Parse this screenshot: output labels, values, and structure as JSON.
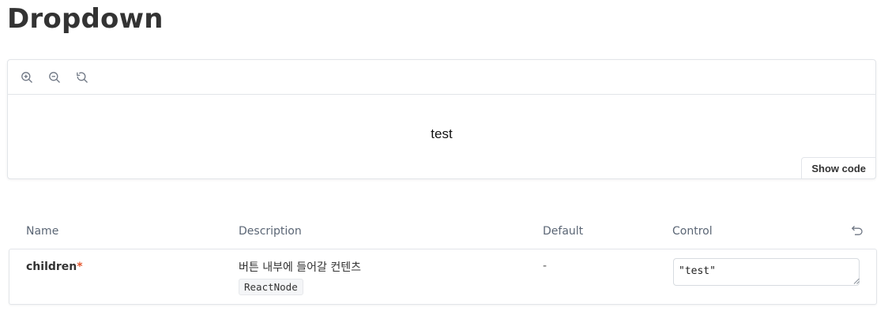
{
  "page": {
    "title": "Dropdown"
  },
  "canvas": {
    "toolbar": {
      "zoom_in_icon": "zoom-in-icon",
      "zoom_out_icon": "zoom-out-icon",
      "reset_zoom_icon": "reset-zoom-icon"
    },
    "preview_text": "test",
    "show_code_label": "Show code"
  },
  "args_table": {
    "headers": {
      "name": "Name",
      "description": "Description",
      "default": "Default",
      "control": "Control"
    },
    "reset_icon": "undo-icon",
    "rows": [
      {
        "name": "children",
        "required_mark": "*",
        "description": "버튼 내부에 들어갈 컨텐츠",
        "type": "ReactNode",
        "default": "-",
        "control_value": "\"test\""
      }
    ]
  },
  "colors": {
    "border": "#e2e5e9",
    "required": "#e4572e",
    "text": "#333333",
    "muted": "#5b6675"
  }
}
